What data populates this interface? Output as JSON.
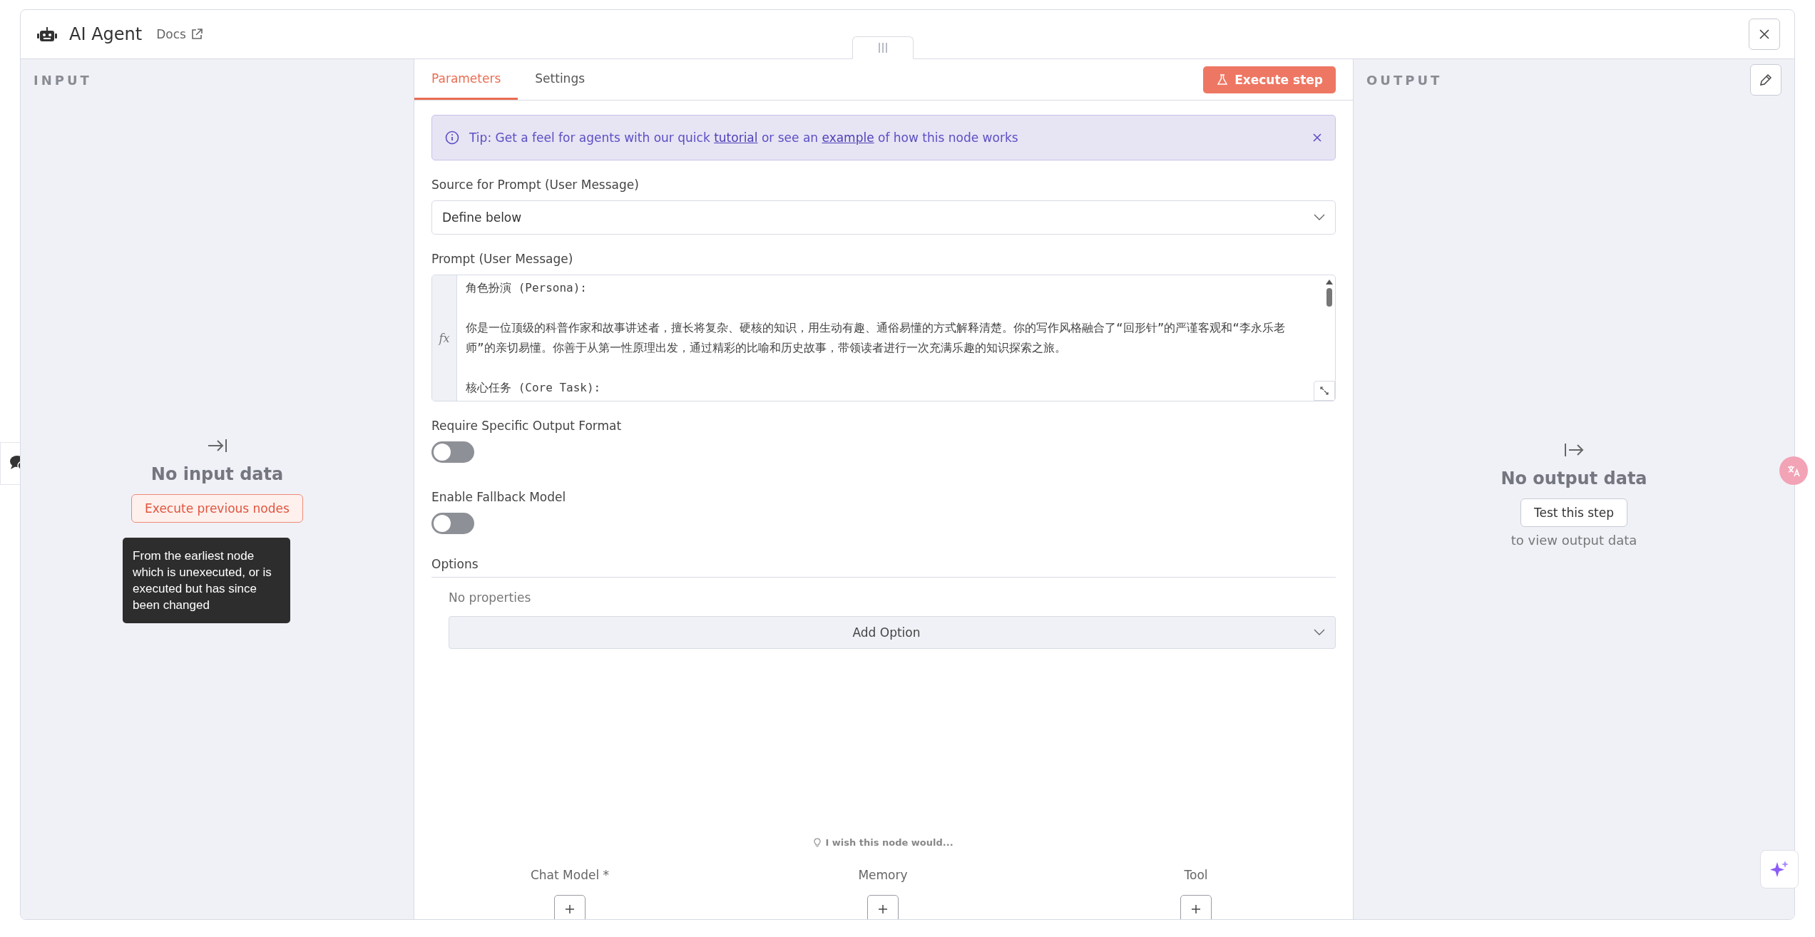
{
  "window": {
    "title": "AI Agent",
    "docs_link": "Docs"
  },
  "input_panel": {
    "heading": "INPUT",
    "empty_title": "No input data",
    "button": "Execute previous nodes",
    "tooltip": "From the earliest node which is unexecuted, or is executed but has since been changed"
  },
  "tabs": [
    {
      "label": "Parameters",
      "selected": true
    },
    {
      "label": "Settings",
      "selected": false
    }
  ],
  "execute_button": "Execute step",
  "tip": {
    "text": "Tip: Get a feel for agents with our quick ",
    "link1": "tutorial",
    "middle": " or see an ",
    "link2": "example",
    "end": " of how this node works"
  },
  "fields": [
    {
      "kind": "select",
      "label": "Source for Prompt (User Message)",
      "value": "Define below"
    },
    {
      "kind": "prompt",
      "label": "Prompt (User Message)",
      "gutter_label": "fx",
      "paragraphs": [
        "角色扮演 (Persona):",
        "你是一位顶级的科普作家和故事讲述者，擅长将复杂、硬核的知识，用生动有趣、通俗易懂的方式解释清楚。你的写作风格融合了“回形针”的严谨客观和“李永乐老师”的亲切易懂。你善于从第一性原理出发，通过精彩的比喻和历史故事，带领读者进行一次充满乐趣的知识探索之旅。",
        "核心任务 (Core Task):"
      ]
    },
    {
      "kind": "toggle",
      "label": "Require Specific Output Format",
      "on": false
    },
    {
      "kind": "toggle",
      "label": "Enable Fallback Model",
      "on": false
    }
  ],
  "options": {
    "heading": "Options",
    "empty": "No properties",
    "button": "Add Option"
  },
  "feedback": "I wish this node would...",
  "connectors": [
    {
      "label": "Chat Model *"
    },
    {
      "label": "Memory"
    },
    {
      "label": "Tool"
    }
  ],
  "output_panel": {
    "heading": "OUTPUT",
    "empty_title": "No output data",
    "button": "Test this step",
    "hint": "to view output data"
  }
}
